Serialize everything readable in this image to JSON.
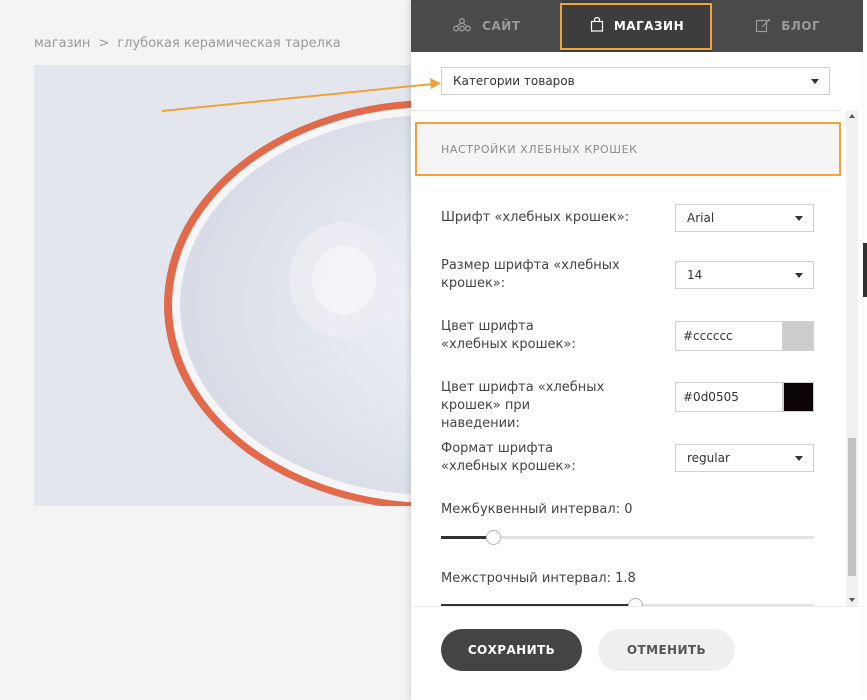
{
  "breadcrumb": {
    "root": "магазин",
    "separator": ">",
    "current": "глубокая керамическая тарелка"
  },
  "tabs": [
    {
      "label": "САЙТ",
      "icon": "sitemap-icon"
    },
    {
      "label": "МАГАЗИН",
      "icon": "shopping-bag-icon",
      "active": true
    },
    {
      "label": "БЛОГ",
      "icon": "edit-icon"
    }
  ],
  "category_select": {
    "value": "Категории товаров"
  },
  "section": {
    "title": "НАСТРОЙКИ ХЛЕБНЫХ КРОШЕК"
  },
  "settings": {
    "font": {
      "label": "Шрифт «хлебных крошек»:",
      "value": "Arial"
    },
    "font_size": {
      "label": "Размер шрифта «хлебных крошек»:",
      "value": "14"
    },
    "color": {
      "label": "Цвет шрифта «хлебных крошек»:",
      "value": "#cccccc",
      "swatch": "#cccccc"
    },
    "hover_color": {
      "label": "Цвет шрифта «хлебных крошек» при наведении:",
      "value": "#0d0505",
      "swatch": "#0d0505"
    },
    "font_format": {
      "label": "Формат шрифта «хлебных крошек»:",
      "value": "regular"
    },
    "letter_spacing": {
      "label": "Межбуквенный интервал: 0",
      "level": 0.14
    },
    "line_height": {
      "label": "Межстрочный интервал: 1.8",
      "level": 0.52
    }
  },
  "footer": {
    "save_label": "СОХРАНИТЬ",
    "cancel_label": "ОТМЕНИТЬ"
  },
  "colors": {
    "accent": "#f0a33a",
    "tab_bar": "#4a4a4a",
    "plate_rim": "#e2694a"
  }
}
